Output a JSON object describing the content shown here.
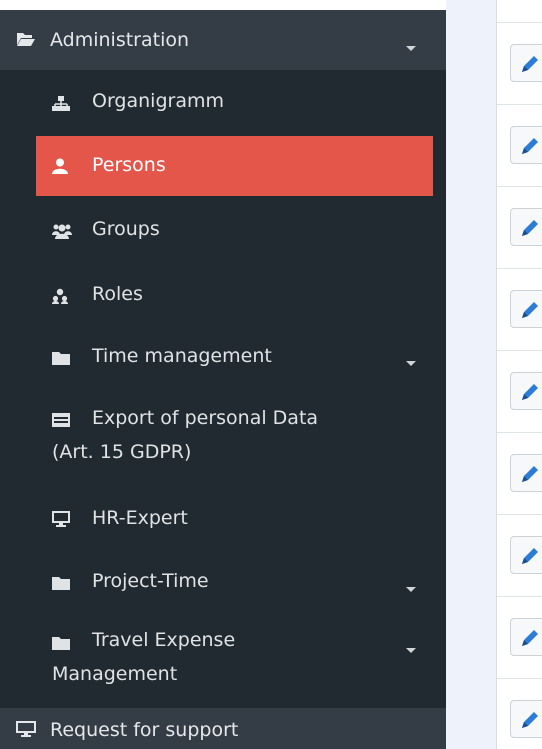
{
  "sidebar": {
    "admin_section": {
      "label": "Administration",
      "icon": "folder-open-icon"
    },
    "items": [
      {
        "label": "Organigramm",
        "icon": "sitemap-icon"
      },
      {
        "label": "Persons",
        "icon": "user-icon",
        "active": true
      },
      {
        "label": "Groups",
        "icon": "users-icon"
      },
      {
        "label": "Roles",
        "icon": "user-roles-icon"
      },
      {
        "label": "Time management",
        "icon": "folder-icon",
        "expandable": true
      },
      {
        "label": "Export of personal Data",
        "label2": "(Art. 15 GDPR)",
        "icon": "table-icon"
      },
      {
        "label": "HR-Expert",
        "icon": "desktop-icon"
      },
      {
        "label": "Project-Time",
        "icon": "folder-icon",
        "expandable": true
      },
      {
        "label": "Travel Expense",
        "label2": "Management",
        "icon": "folder-icon",
        "expandable": true
      }
    ],
    "support_section": {
      "label": "Request for support",
      "icon": "desktop-icon"
    }
  },
  "colors": {
    "sidebar_bg": "#222a31",
    "section_bg": "#343d45",
    "active_bg": "#e4564a",
    "edit_icon": "#2c7bd6"
  },
  "edit_rows": [
    "edit",
    "edit",
    "edit",
    "edit",
    "edit",
    "edit",
    "edit",
    "edit",
    "edit"
  ]
}
